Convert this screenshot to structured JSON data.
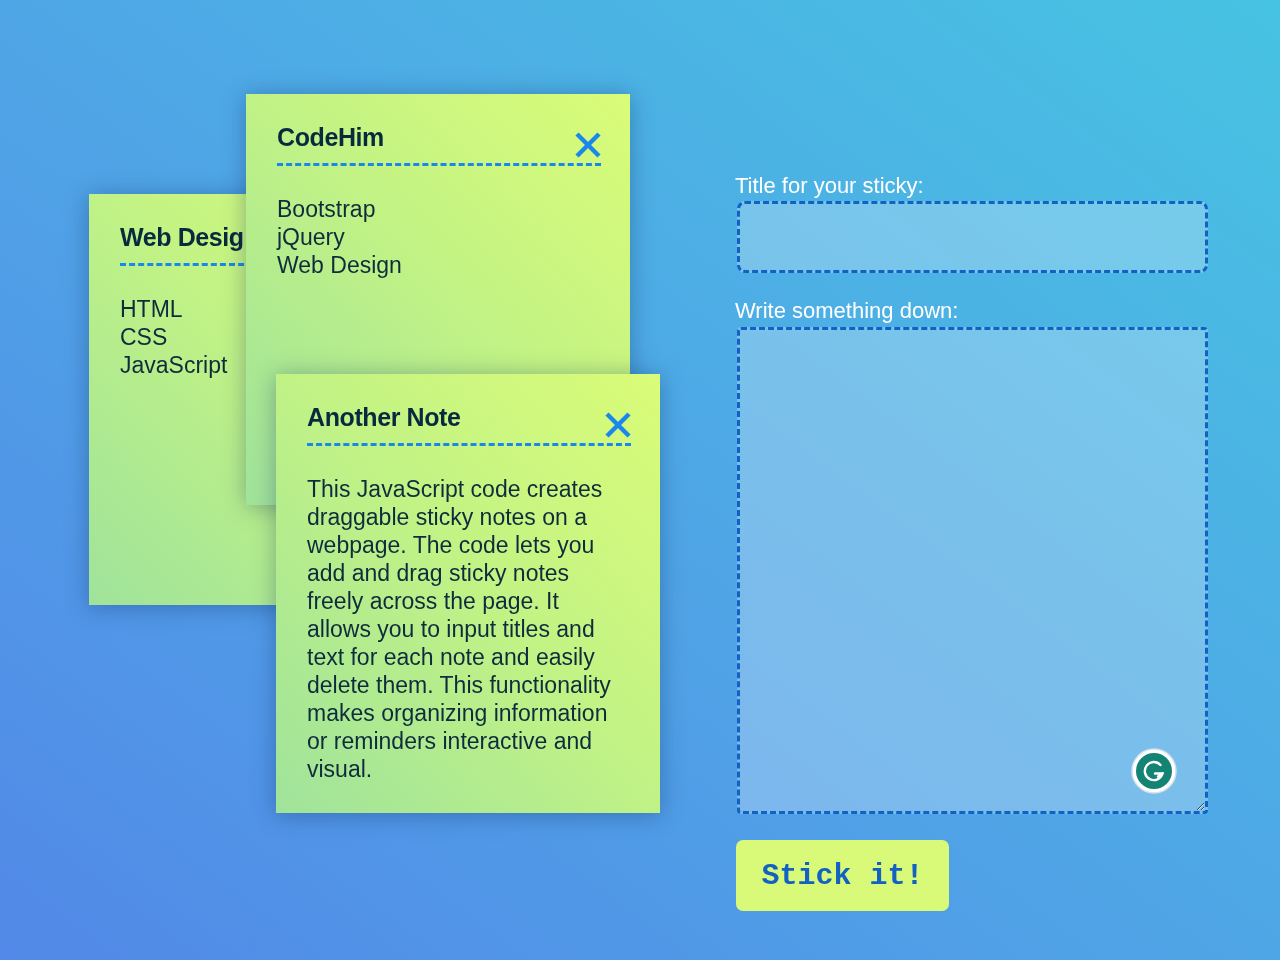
{
  "notes": [
    {
      "title": "Web Desig",
      "body": "HTML\nCSS\nJavaScript"
    },
    {
      "title": "CodeHim",
      "closable": true,
      "body": "Bootstrap\njQuery\nWeb Design"
    },
    {
      "title": "Another Note",
      "closable": true,
      "body": "This JavaScript code creates draggable sticky notes on a webpage. The code lets you add and drag sticky notes freely across the page. It allows you to input titles and text for each note and easily delete them. This functionality makes organizing information or reminders interactive and visual."
    }
  ],
  "form": {
    "title_label": "Title for your sticky:",
    "message_label": "Write something down:",
    "submit_button": "Stick it!"
  }
}
